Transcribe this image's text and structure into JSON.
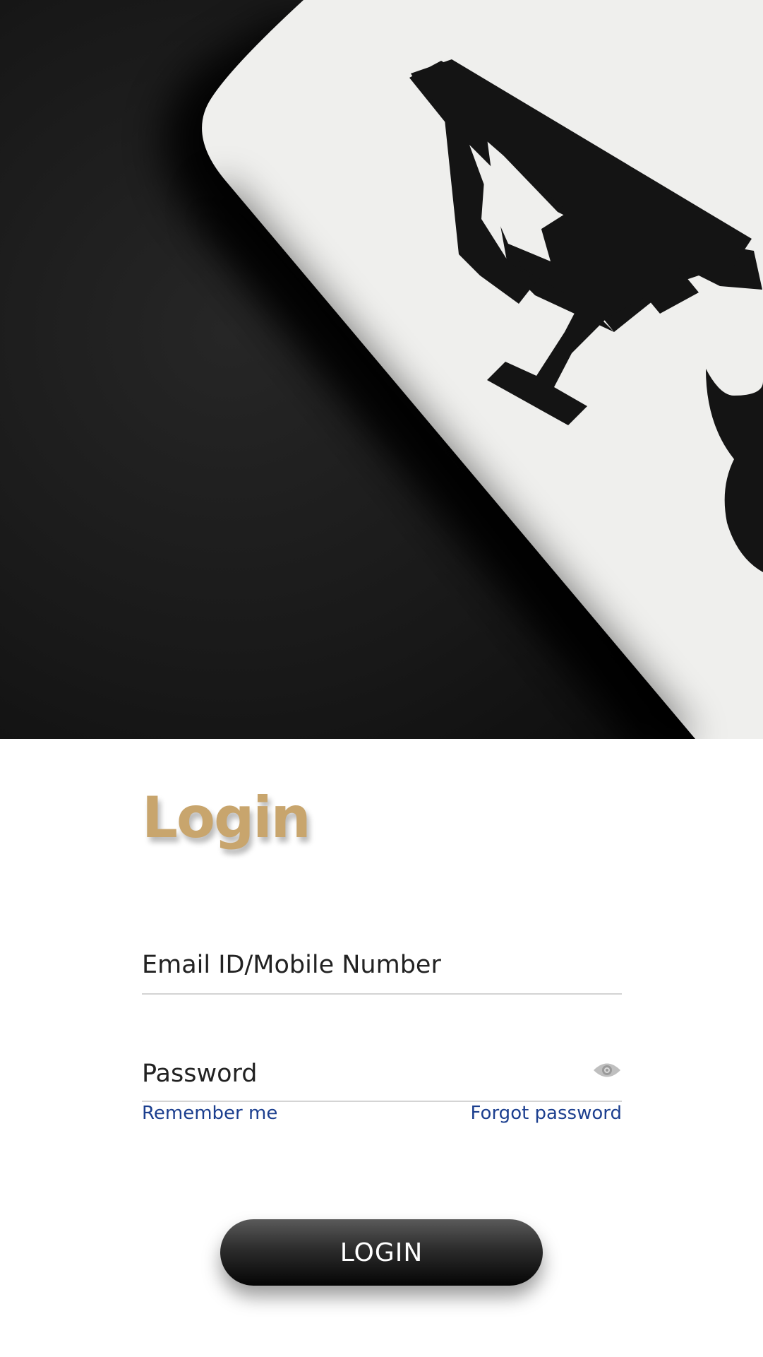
{
  "hero": {
    "card_letter": "A",
    "icon": "ace-of-spades-card-image"
  },
  "login": {
    "title": "Login",
    "email_placeholder": "Email ID/Mobile Number",
    "password_placeholder": "Password",
    "password_toggle_icon": "eye-icon",
    "remember_label": "Remember me",
    "forgot_label": "Forgot password",
    "submit_label": "LOGIN"
  },
  "colors": {
    "title": "#c8a56d",
    "link": "#1c3f8f",
    "button_top": "#5a5a5a",
    "button_bottom": "#050505",
    "field_underline": "#d4d4d4"
  }
}
